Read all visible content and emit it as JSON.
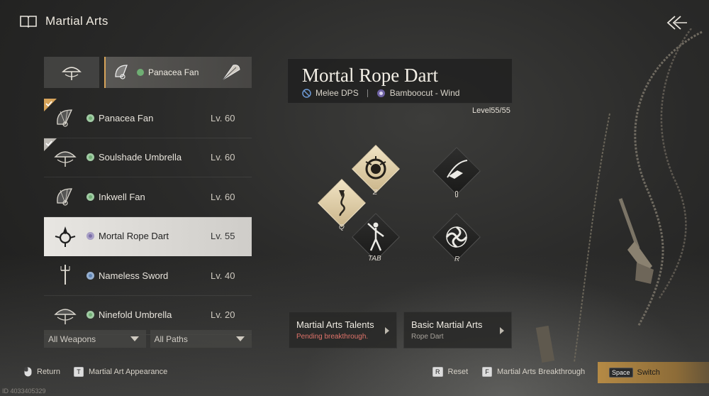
{
  "header": {
    "title": "Martial Arts",
    "back_icon": "back-arrows-icon",
    "book_icon": "book-icon"
  },
  "weapon_bar": {
    "slot1_icon": "umbrella-icon",
    "slot2_label": "Panacea Fan",
    "slot2_icon": "fan-icon"
  },
  "weapons": [
    {
      "name": "Panacea Fan",
      "level": "Lv. 60",
      "path_color": "#6fae73",
      "equipped": true,
      "check_color": "#d7a45a",
      "icon": "fan-icon"
    },
    {
      "name": "Soulshade Umbrella",
      "level": "Lv. 60",
      "path_color": "#6fae73",
      "equipped": true,
      "check_color": "#bdbab4",
      "icon": "umbrella-icon"
    },
    {
      "name": "Inkwell Fan",
      "level": "Lv. 60",
      "path_color": "#6fae73",
      "equipped": false,
      "icon": "fan-icon"
    },
    {
      "name": "Mortal Rope Dart",
      "level": "Lv. 55",
      "path_color": "#7b6ea8",
      "equipped": false,
      "selected": true,
      "icon": "rope-dart-icon"
    },
    {
      "name": "Nameless Sword",
      "level": "Lv. 40",
      "path_color": "#5e84b5",
      "equipped": false,
      "icon": "sword-icon"
    },
    {
      "name": "Ninefold Umbrella",
      "level": "Lv. 20",
      "path_color": "#6fae73",
      "equipped": false,
      "icon": "umbrella-icon"
    }
  ],
  "filters": {
    "weapons": "All Weapons",
    "paths": "All Paths"
  },
  "info": {
    "name": "Mortal Rope Dart",
    "role": "Melee DPS",
    "path": "Bamboocut - Wind",
    "level": "Level55/55"
  },
  "skills": [
    {
      "key": "Q",
      "style": "gold",
      "icon": "rope-dart-skill-icon"
    },
    {
      "key": "Z",
      "style": "gold",
      "icon": "coil-skill-icon"
    },
    {
      "key": "TAB",
      "style": "dark",
      "icon": "figure-skill-icon"
    },
    {
      "key": "",
      "style": "dark",
      "icon": "leap-skill-icon"
    },
    {
      "key": "R",
      "style": "dark",
      "icon": "whirl-skill-icon"
    }
  ],
  "cards": {
    "talents": {
      "title": "Martial Arts Talents",
      "sub": "Pending breakthrough.",
      "sub_color": "#e0736a"
    },
    "basic": {
      "title": "Basic Martial Arts",
      "sub": "Rope Dart",
      "sub_color": "#a7a29a"
    }
  },
  "footer": {
    "return_label": "Return",
    "appearance_key": "T",
    "appearance_label": "Martial Art Appearance",
    "reset_key": "R",
    "reset_label": "Reset",
    "breakthrough_key": "F",
    "breakthrough_label": "Martial Arts Breakthrough",
    "switch_key": "Space",
    "switch_label": "Switch"
  },
  "uid": "ID 4033405329"
}
